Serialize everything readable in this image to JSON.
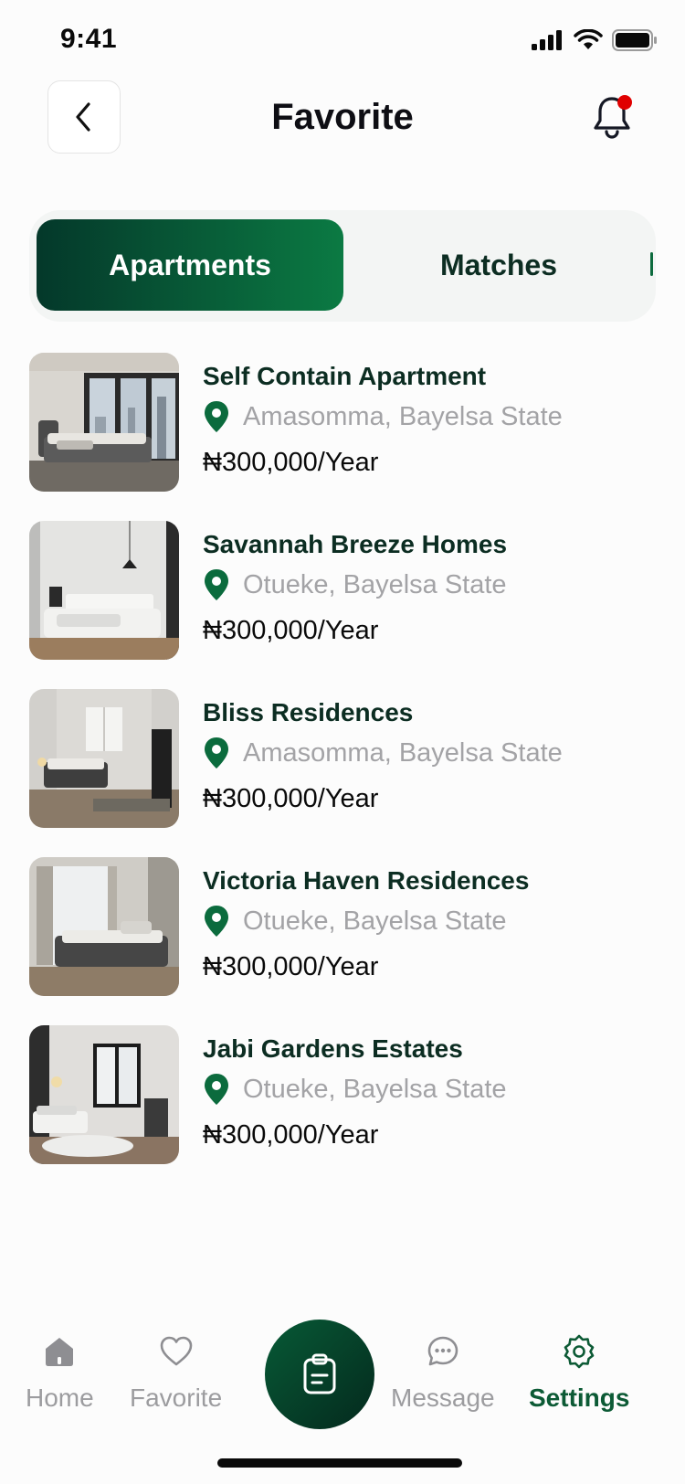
{
  "status_bar": {
    "time": "9:41"
  },
  "header": {
    "title": "Favorite",
    "notification_dot_color": "#e00000"
  },
  "tabs": [
    {
      "label": "Apartments",
      "active": true
    },
    {
      "label": "Matches",
      "active": false
    }
  ],
  "listings": [
    {
      "title": "Self Contain Apartment",
      "location": "Amasomma, Bayelsa State",
      "price": "₦300,000/Year",
      "image": "bedroom-photo-city-view"
    },
    {
      "title": "Savannah Breeze Homes",
      "location": "Otueke, Bayelsa State",
      "price": "₦300,000/Year",
      "image": "bedroom-photo-white"
    },
    {
      "title": "Bliss Residences",
      "location": "Amasomma, Bayelsa State",
      "price": "₦300,000/Year",
      "image": "bedroom-photo-window"
    },
    {
      "title": "Victoria Haven Residences",
      "location": "Otueke, Bayelsa State",
      "price": "₦300,000/Year",
      "image": "bedroom-photo-curtains"
    },
    {
      "title": "Jabi Gardens Estates",
      "location": "Otueke, Bayelsa State",
      "price": "₦300,000/Year",
      "image": "bedroom-photo-rug"
    }
  ],
  "tabbar": {
    "home": "Home",
    "favorite": "Favorite",
    "message": "Message",
    "settings": "Settings",
    "active": "Settings"
  },
  "colors": {
    "brand_dark": "#04382a",
    "brand_green": "#0b7a43",
    "location_pin": "#0b6b3d",
    "muted_text": "#a3a3a6"
  }
}
